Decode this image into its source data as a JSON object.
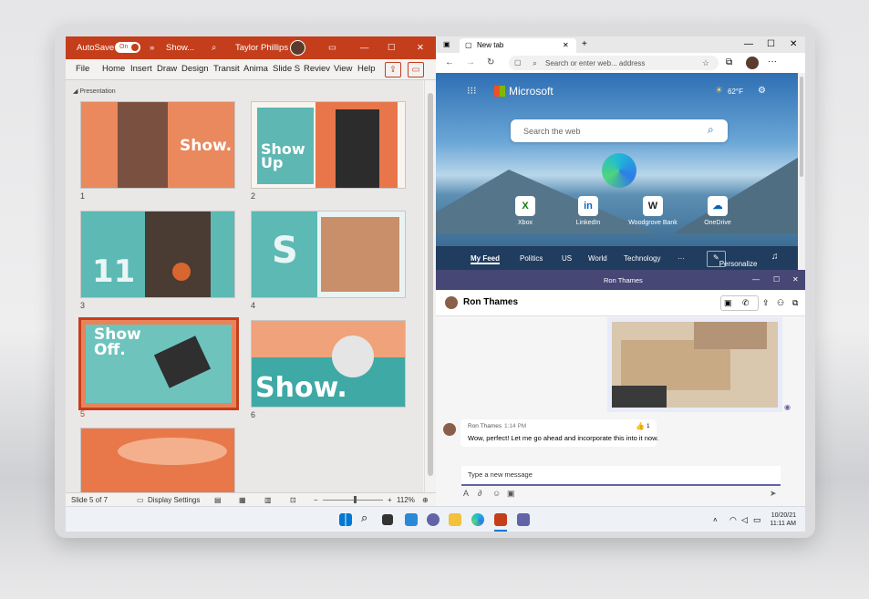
{
  "powerpoint": {
    "title_bar": {
      "autosave": "AutoSave",
      "toggle": "On",
      "file_name": "Show...",
      "user": "Taylor Phillips"
    },
    "menu": [
      "File",
      "Home",
      "Insert",
      "Draw",
      "Design",
      "Transit",
      "Anima",
      "Slide S",
      "Reviev",
      "View",
      "Help"
    ],
    "section": "Presentation",
    "slides": [
      {
        "num": "1",
        "word": "Show."
      },
      {
        "num": "2",
        "word": "Show\nUp"
      },
      {
        "num": "3",
        "word": "11"
      },
      {
        "num": "4",
        "word": "S"
      },
      {
        "num": "5",
        "word": "Show\nOff."
      },
      {
        "num": "6",
        "word": "Show."
      },
      {
        "num": "",
        "word": ""
      }
    ],
    "status": {
      "slide_count": "Slide 5 of 7",
      "display_settings": "Display Settings",
      "zoom": "112%"
    },
    "accent": "#c43e1c"
  },
  "edge": {
    "tab_title": "New tab",
    "address_placeholder": "Search or enter web... address",
    "brand": "Microsoft",
    "weather": "62°F",
    "search_placeholder": "Search the web",
    "quick_links": [
      {
        "label": "Xbox",
        "icon": "xbox-icon"
      },
      {
        "label": "LinkedIn",
        "icon": "linkedin-icon"
      },
      {
        "label": "Woodgrove Bank",
        "icon": "bank-icon"
      },
      {
        "label": "OneDrive",
        "icon": "onedrive-icon"
      }
    ],
    "feed_tabs": [
      "My Feed",
      "Politics",
      "US",
      "World",
      "Technology",
      "···"
    ],
    "personalize": "Personalize"
  },
  "teams": {
    "window_title": "Ron Thames",
    "chat_name": "Ron Thames",
    "message": {
      "sender": "Ron Thames",
      "time": "1:14 PM",
      "text": "Wow, perfect! Let me go ahead and incorporate this into it now.",
      "reaction_count": "1"
    },
    "compose_placeholder": "Type a new message",
    "accent": "#464775"
  },
  "taskbar": {
    "date": "10/20/21",
    "time": "11:11 AM"
  }
}
